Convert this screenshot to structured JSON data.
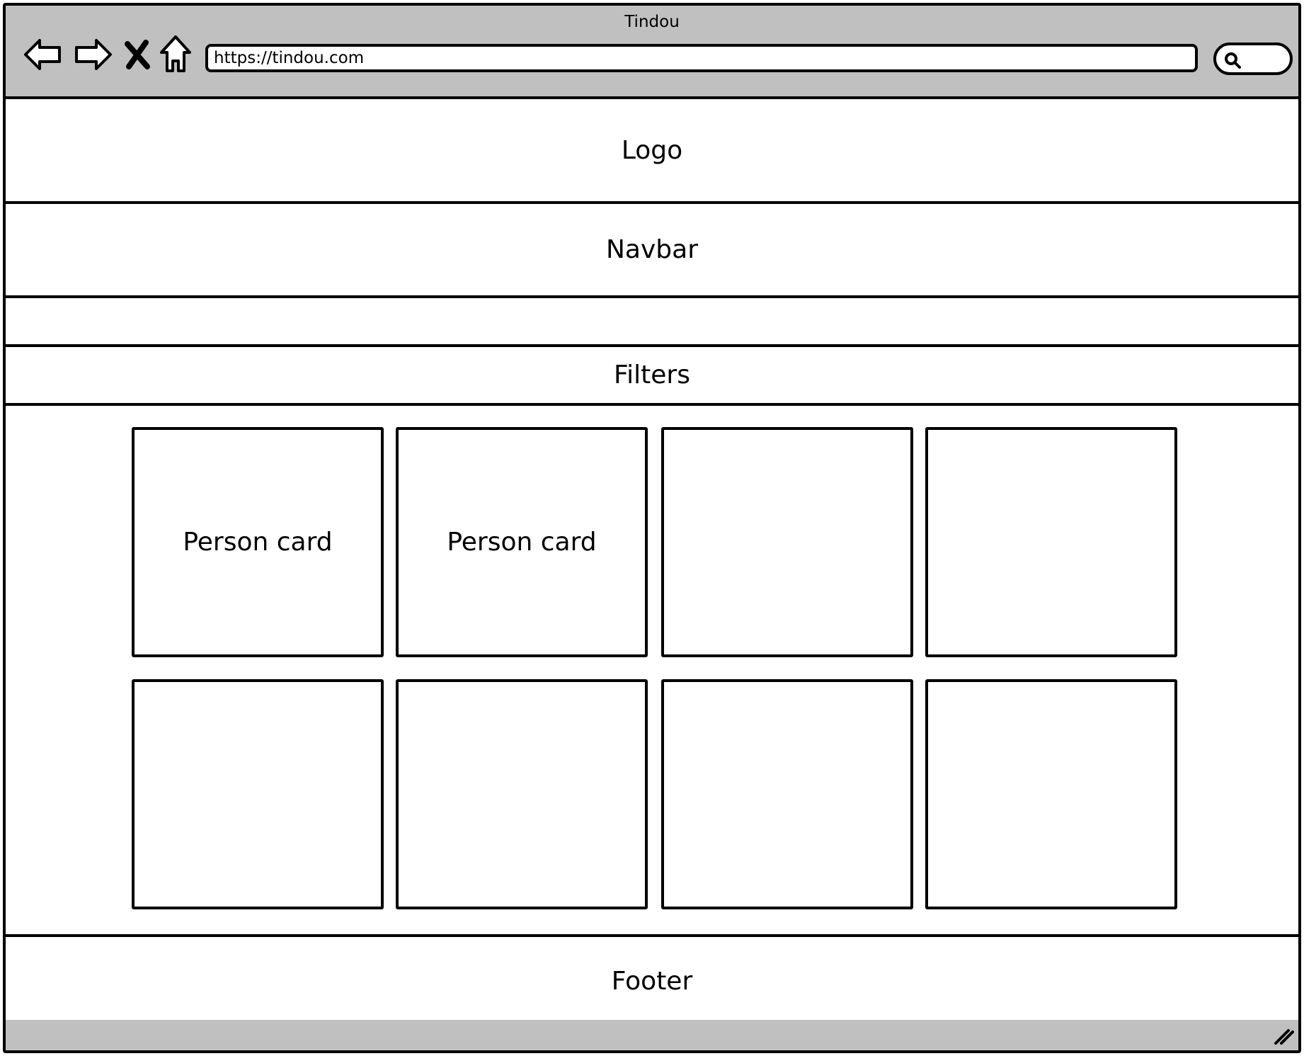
{
  "window": {
    "title": "Tindou"
  },
  "toolbar": {
    "back_icon": "back-arrow-icon",
    "forward_icon": "forward-arrow-icon",
    "stop_icon": "close-icon",
    "home_icon": "home-icon",
    "url": "https://tindou.com",
    "search_icon": "search-icon"
  },
  "page": {
    "logo_label": "Logo",
    "navbar_label": "Navbar",
    "filters_label": "Filters",
    "footer_label": "Footer",
    "cards": [
      {
        "label": "Person card"
      },
      {
        "label": "Person card"
      },
      {
        "label": ""
      },
      {
        "label": ""
      },
      {
        "label": ""
      },
      {
        "label": ""
      },
      {
        "label": ""
      },
      {
        "label": ""
      }
    ]
  },
  "colors": {
    "chrome": "#c0c0c0",
    "stroke": "#000000",
    "background": "#ffffff"
  }
}
